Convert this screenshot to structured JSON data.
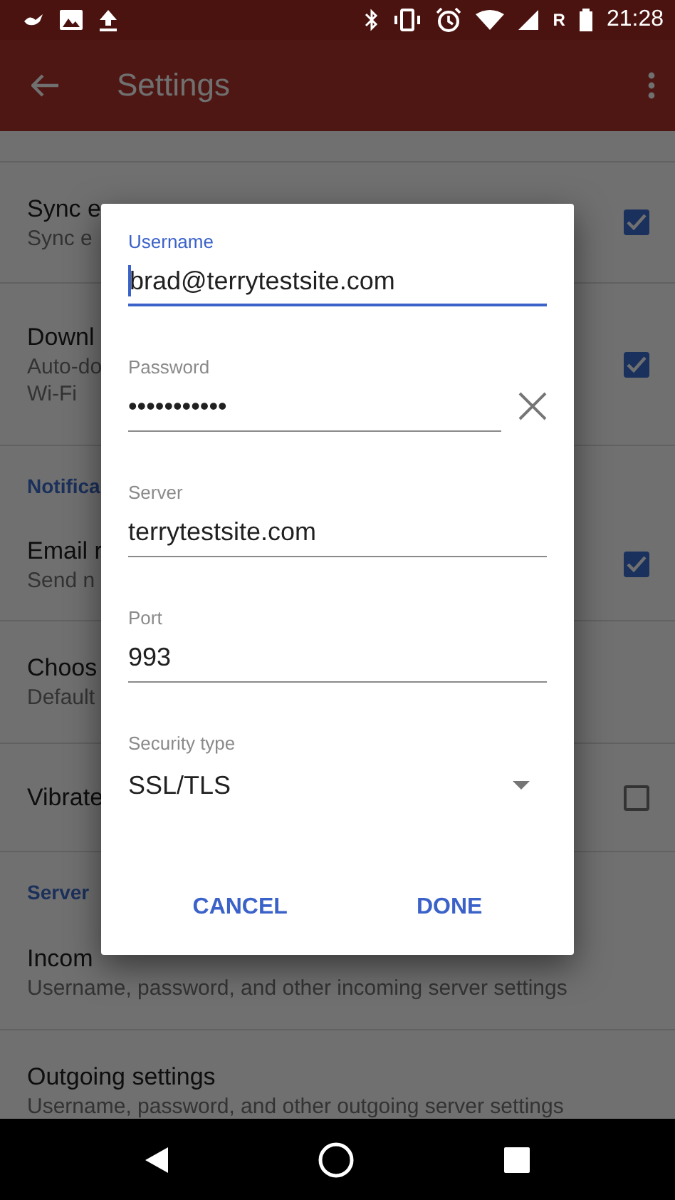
{
  "status_bar": {
    "network_letter": "R",
    "time": "21:28"
  },
  "app_bar": {
    "title": "Settings"
  },
  "settings": {
    "items": [
      {
        "kind": "checkbox_row",
        "title": "Sync e",
        "summary": [
          "Sync e"
        ],
        "checked": true
      },
      {
        "kind": "checkbox_row",
        "title": "Downl",
        "summary": [
          "Auto-do",
          "Wi-Fi"
        ],
        "checked": true
      },
      {
        "kind": "header",
        "title": "Notifica"
      },
      {
        "kind": "checkbox_row",
        "title": "Email r",
        "summary": [
          "Send n"
        ],
        "checked": true
      },
      {
        "kind": "row",
        "title": "Choos",
        "summary": [
          "Default"
        ]
      },
      {
        "kind": "checkbox_row",
        "title": "Vibrate",
        "checked": false
      },
      {
        "kind": "header",
        "title": "Server"
      },
      {
        "kind": "row",
        "title": "Incom",
        "summary": [
          "Username, password, and other incoming server settings"
        ]
      },
      {
        "kind": "row",
        "title": "Outgoing settings",
        "summary": [
          "Username, password, and other outgoing server settings"
        ]
      }
    ]
  },
  "dialog": {
    "fields": [
      {
        "kind": "text",
        "label": "Username",
        "value": "brad@terrytestsite.com",
        "focused": true
      },
      {
        "kind": "password",
        "label": "Password",
        "value": "•••••••••••",
        "focused": false
      },
      {
        "kind": "text",
        "label": "Server",
        "value": "terrytestsite.com",
        "focused": false
      },
      {
        "kind": "text",
        "label": "Port",
        "value": "993",
        "focused": false
      },
      {
        "kind": "select",
        "label": "Security type",
        "value": "SSL/TLS",
        "focused": false
      }
    ],
    "buttons": [
      "CANCEL",
      "DONE"
    ]
  }
}
